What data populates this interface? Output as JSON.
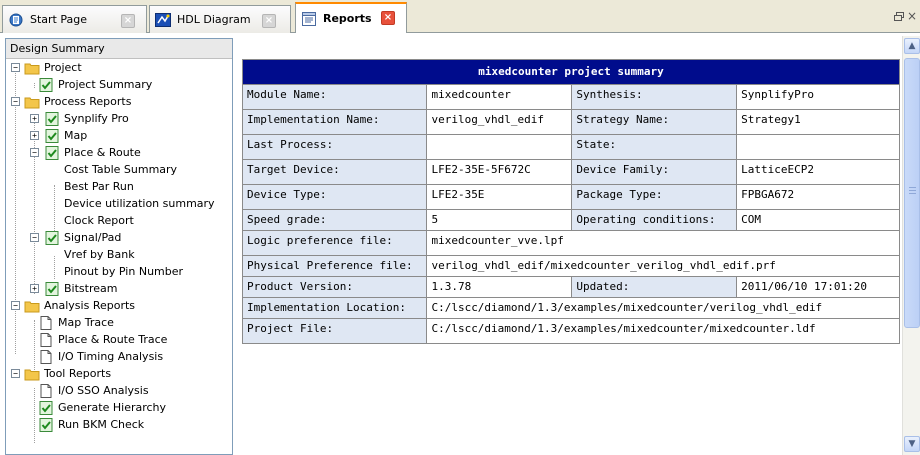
{
  "tabs": [
    {
      "label": "Start Page",
      "icon": "start-page-icon"
    },
    {
      "label": "HDL Diagram",
      "icon": "hdl-diagram-icon"
    },
    {
      "label": "Reports",
      "icon": "reports-icon",
      "active": true
    }
  ],
  "window_controls": {
    "restore": "restore-icon",
    "close": "×"
  },
  "tree": {
    "header": "Design Summary",
    "nodes": {
      "project": "Project",
      "project_summary": "Project Summary",
      "process_reports": "Process Reports",
      "synplify_pro": "Synplify Pro",
      "map": "Map",
      "place_route": "Place & Route",
      "cost_table": "Cost Table Summary",
      "best_par": "Best Par Run",
      "device_util": "Device utilization summary",
      "clock_report": "Clock Report",
      "signal_pad": "Signal/Pad",
      "vref_bank": "Vref by Bank",
      "pinout": "Pinout by Pin Number",
      "bitstream": "Bitstream",
      "analysis_reports": "Analysis Reports",
      "map_trace": "Map Trace",
      "par_trace": "Place & Route Trace",
      "io_timing": "I/O Timing Analysis",
      "tool_reports": "Tool Reports",
      "io_sso": "I/O SSO Analysis",
      "gen_hierarchy": "Generate Hierarchy",
      "run_bkm": "Run BKM Check"
    }
  },
  "summary": {
    "title": "mixedcounter project summary",
    "module_name_label": "Module Name:",
    "module_name": "mixedcounter",
    "synthesis_label": "Synthesis:",
    "synthesis": "SynplifyPro",
    "impl_name_label": "Implementation Name:",
    "impl_name": "verilog_vhdl_edif",
    "strategy_label": "Strategy Name:",
    "strategy": "Strategy1",
    "last_process_label": "Last Process:",
    "last_process": "",
    "state_label": "State:",
    "state": "",
    "target_device_label": "Target Device:",
    "target_device": "LFE2-35E-5F672C",
    "device_family_label": "Device Family:",
    "device_family": "LatticeECP2",
    "device_type_label": "Device Type:",
    "device_type": "LFE2-35E",
    "package_type_label": "Package Type:",
    "package_type": "FPBGA672",
    "speed_grade_label": "Speed grade:",
    "speed_grade": "5",
    "operating_label": "Operating conditions:",
    "operating": "COM",
    "logic_pref_label": "Logic preference file:",
    "logic_pref": "mixedcounter_vve.lpf",
    "phys_pref_label": "Physical Preference file:",
    "phys_pref": "verilog_vhdl_edif/mixedcounter_verilog_vhdl_edif.prf",
    "product_version_label": "Product Version:",
    "product_version": "1.3.78",
    "updated_label": "Updated:",
    "updated": "2011/06/10 17:01:20",
    "impl_location_label": "Implementation Location:",
    "impl_location": "C:/lscc/diamond/1.3/examples/mixedcounter/verilog_vhdl_edif",
    "project_file_label": "Project File:",
    "project_file": "C:/lscc/diamond/1.3/examples/mixedcounter/mixedcounter.ldf"
  },
  "colors": {
    "header_bg": "#000c8c",
    "label_bg": "#dfe7f3",
    "active_tab_accent": "#ff8a00",
    "check_green": "#3fae3f",
    "folder_yellow": "#f3c64a"
  }
}
